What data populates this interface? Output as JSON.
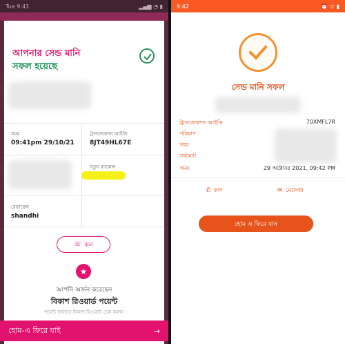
{
  "left": {
    "status_time": "Tue 9:41",
    "status_icons": "signal-wifi-battery",
    "title_line1": "আপনার সেন্ড মানি",
    "title_line2": "সফল হয়েছে",
    "time_label": "সময়",
    "time_value": "09:41pm 29/10/21",
    "trx_label": "ট্রানজেকশন আইডি",
    "trx_value": "8JT49HL67E",
    "new_balance_label": "নতুন ব্যালেন্স",
    "reference_label": "রেফারেন্স",
    "reference_value": "shandhi",
    "call_label": "কল",
    "earned_text": "আপনি অর্জন করেছেন",
    "reward_title": "বিকাশ রিওয়ার্ড পয়েন্ট",
    "reward_sub": "পয়েন্ট জানতে বিকাশ রিওয়ার্ড চেক করুন।",
    "home_label": "হোম-এ ফিরে যাই",
    "home_arrow": "→"
  },
  "right": {
    "status_time": "9:42",
    "title": "সেন্ড মানি সফল",
    "rows": [
      {
        "label": "ট্রানজেকশন আইডি",
        "value": "70XMFL7R"
      },
      {
        "label": "পরিমাণ",
        "value": ""
      },
      {
        "label": "খরচ",
        "value": ""
      },
      {
        "label": "সর্বমোট",
        "value": ""
      },
      {
        "label": "সময়",
        "value": "29 অক্টোবর 2021, 09:42 PM"
      }
    ],
    "call_label": "কল",
    "message_label": "মেসেজ",
    "home_label": "হোম এ ফিরে যান"
  },
  "colors": {
    "bkash_pink": "#e2136e",
    "nagad_orange": "#e6531b",
    "success_green": "#0b8f4b"
  }
}
